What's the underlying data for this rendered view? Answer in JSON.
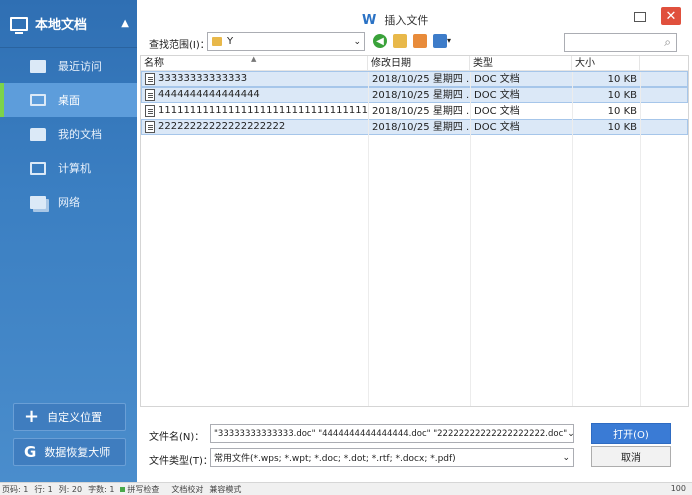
{
  "sidebar": {
    "title": "本地文档",
    "items": [
      {
        "label": "最近访问"
      },
      {
        "label": "桌面"
      },
      {
        "label": "我的文档"
      },
      {
        "label": "计算机"
      },
      {
        "label": "网络"
      }
    ],
    "custom_location": "自定义位置",
    "data_recovery": "数据恢复大师"
  },
  "dialog": {
    "title": "插入文件",
    "title_icon": "W",
    "lookin_label": "查找范围(I)：",
    "lookin_value": "Y",
    "columns": [
      "名称",
      "修改日期",
      "类型",
      "大小"
    ],
    "files": [
      {
        "name": "33333333333333",
        "date": "2018/10/25 星期四 ...",
        "type": "DOC 文档",
        "size": "10 KB",
        "selected": true
      },
      {
        "name": "4444444444444444",
        "date": "2018/10/25 星期四 ...",
        "type": "DOC 文档",
        "size": "10 KB",
        "selected": true
      },
      {
        "name": "11111111111111111111111111111111111111...",
        "date": "2018/10/25 星期四 ...",
        "type": "DOC 文档",
        "size": "10 KB",
        "selected": false
      },
      {
        "name": "22222222222222222222",
        "date": "2018/10/25 星期四 ...",
        "type": "DOC 文档",
        "size": "10 KB",
        "selected": true
      }
    ],
    "filename_label": "文件名(N)：",
    "filename_value": "\"33333333333333.doc\" \"4444444444444444.doc\" \"22222222222222222222.doc\"",
    "filetype_label": "文件类型(T)：",
    "filetype_value": "常用文件(*.wps; *.wpt; *.doc; *.dot; *.rtf; *.docx; *.pdf)",
    "open_label": "打开(O)",
    "cancel_label": "取消"
  },
  "statusbar": {
    "page": "页码: 1",
    "row": "行: 1",
    "col": "列: 20",
    "words": "字数: 1",
    "spellcheck": "拼写检查",
    "proof": "文档校对",
    "compat": "兼容模式",
    "zoom": "100"
  }
}
